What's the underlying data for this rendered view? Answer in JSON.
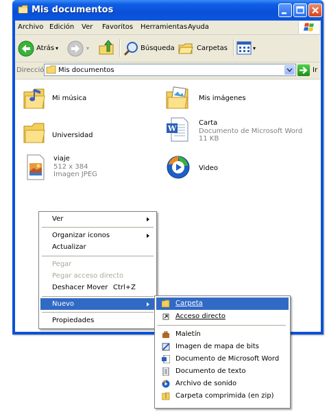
{
  "window": {
    "title": "Mis documentos"
  },
  "menubar": [
    "Archivo",
    "Edición",
    "Ver",
    "Favoritos",
    "Herramientas",
    "Ayuda"
  ],
  "toolbar": {
    "back": "Atrás",
    "search": "Búsqueda",
    "folders": "Carpetas"
  },
  "address": {
    "label": "Dirección",
    "value": "Mis documentos",
    "go": "Ir"
  },
  "files": [
    {
      "name": "Mi música",
      "icon": "music-folder-icon"
    },
    {
      "name": "Mis imágenes",
      "icon": "pictures-folder-icon"
    },
    {
      "name": "Universidad",
      "icon": "folder-icon"
    },
    {
      "name": "Carta",
      "type": "Documento de Microsoft Word",
      "size": "11 KB",
      "icon": "word-document-icon"
    },
    {
      "name": "viaje",
      "dims": "512 x 384",
      "type": "Imagen JPEG",
      "icon": "jpeg-image-icon"
    },
    {
      "name": "Video",
      "icon": "media-player-icon"
    }
  ],
  "context_menu": {
    "items": [
      {
        "label": "Ver",
        "submenu": true
      },
      {
        "label": "Organizar iconos",
        "submenu": true
      },
      {
        "label": "Actualizar"
      },
      {
        "label": "Pegar",
        "disabled": true
      },
      {
        "label": "Pegar acceso directo",
        "disabled": true
      },
      {
        "label": "Deshacer Mover",
        "shortcut": "Ctrl+Z"
      },
      {
        "label": "Nuevo",
        "submenu": true,
        "highlighted": true
      },
      {
        "label": "Propiedades"
      }
    ]
  },
  "new_submenu": {
    "items": [
      {
        "label": "Carpeta",
        "icon": "folder-icon",
        "highlighted": true
      },
      {
        "label": "Acceso directo",
        "icon": "shortcut-icon"
      },
      {
        "label": "Maletín",
        "icon": "briefcase-icon"
      },
      {
        "label": "Imagen de mapa de bits",
        "icon": "bitmap-icon"
      },
      {
        "label": "Documento de Microsoft Word",
        "icon": "word-document-icon"
      },
      {
        "label": "Documento de texto",
        "icon": "text-document-icon"
      },
      {
        "label": "Archivo de sonido",
        "icon": "sound-file-icon"
      },
      {
        "label": "Carpeta comprimida (en zip)",
        "icon": "zip-folder-icon"
      }
    ]
  },
  "colors": {
    "titlebar": "#0a52d8",
    "highlight": "#316ac5",
    "menubar": "#ece9d8"
  }
}
